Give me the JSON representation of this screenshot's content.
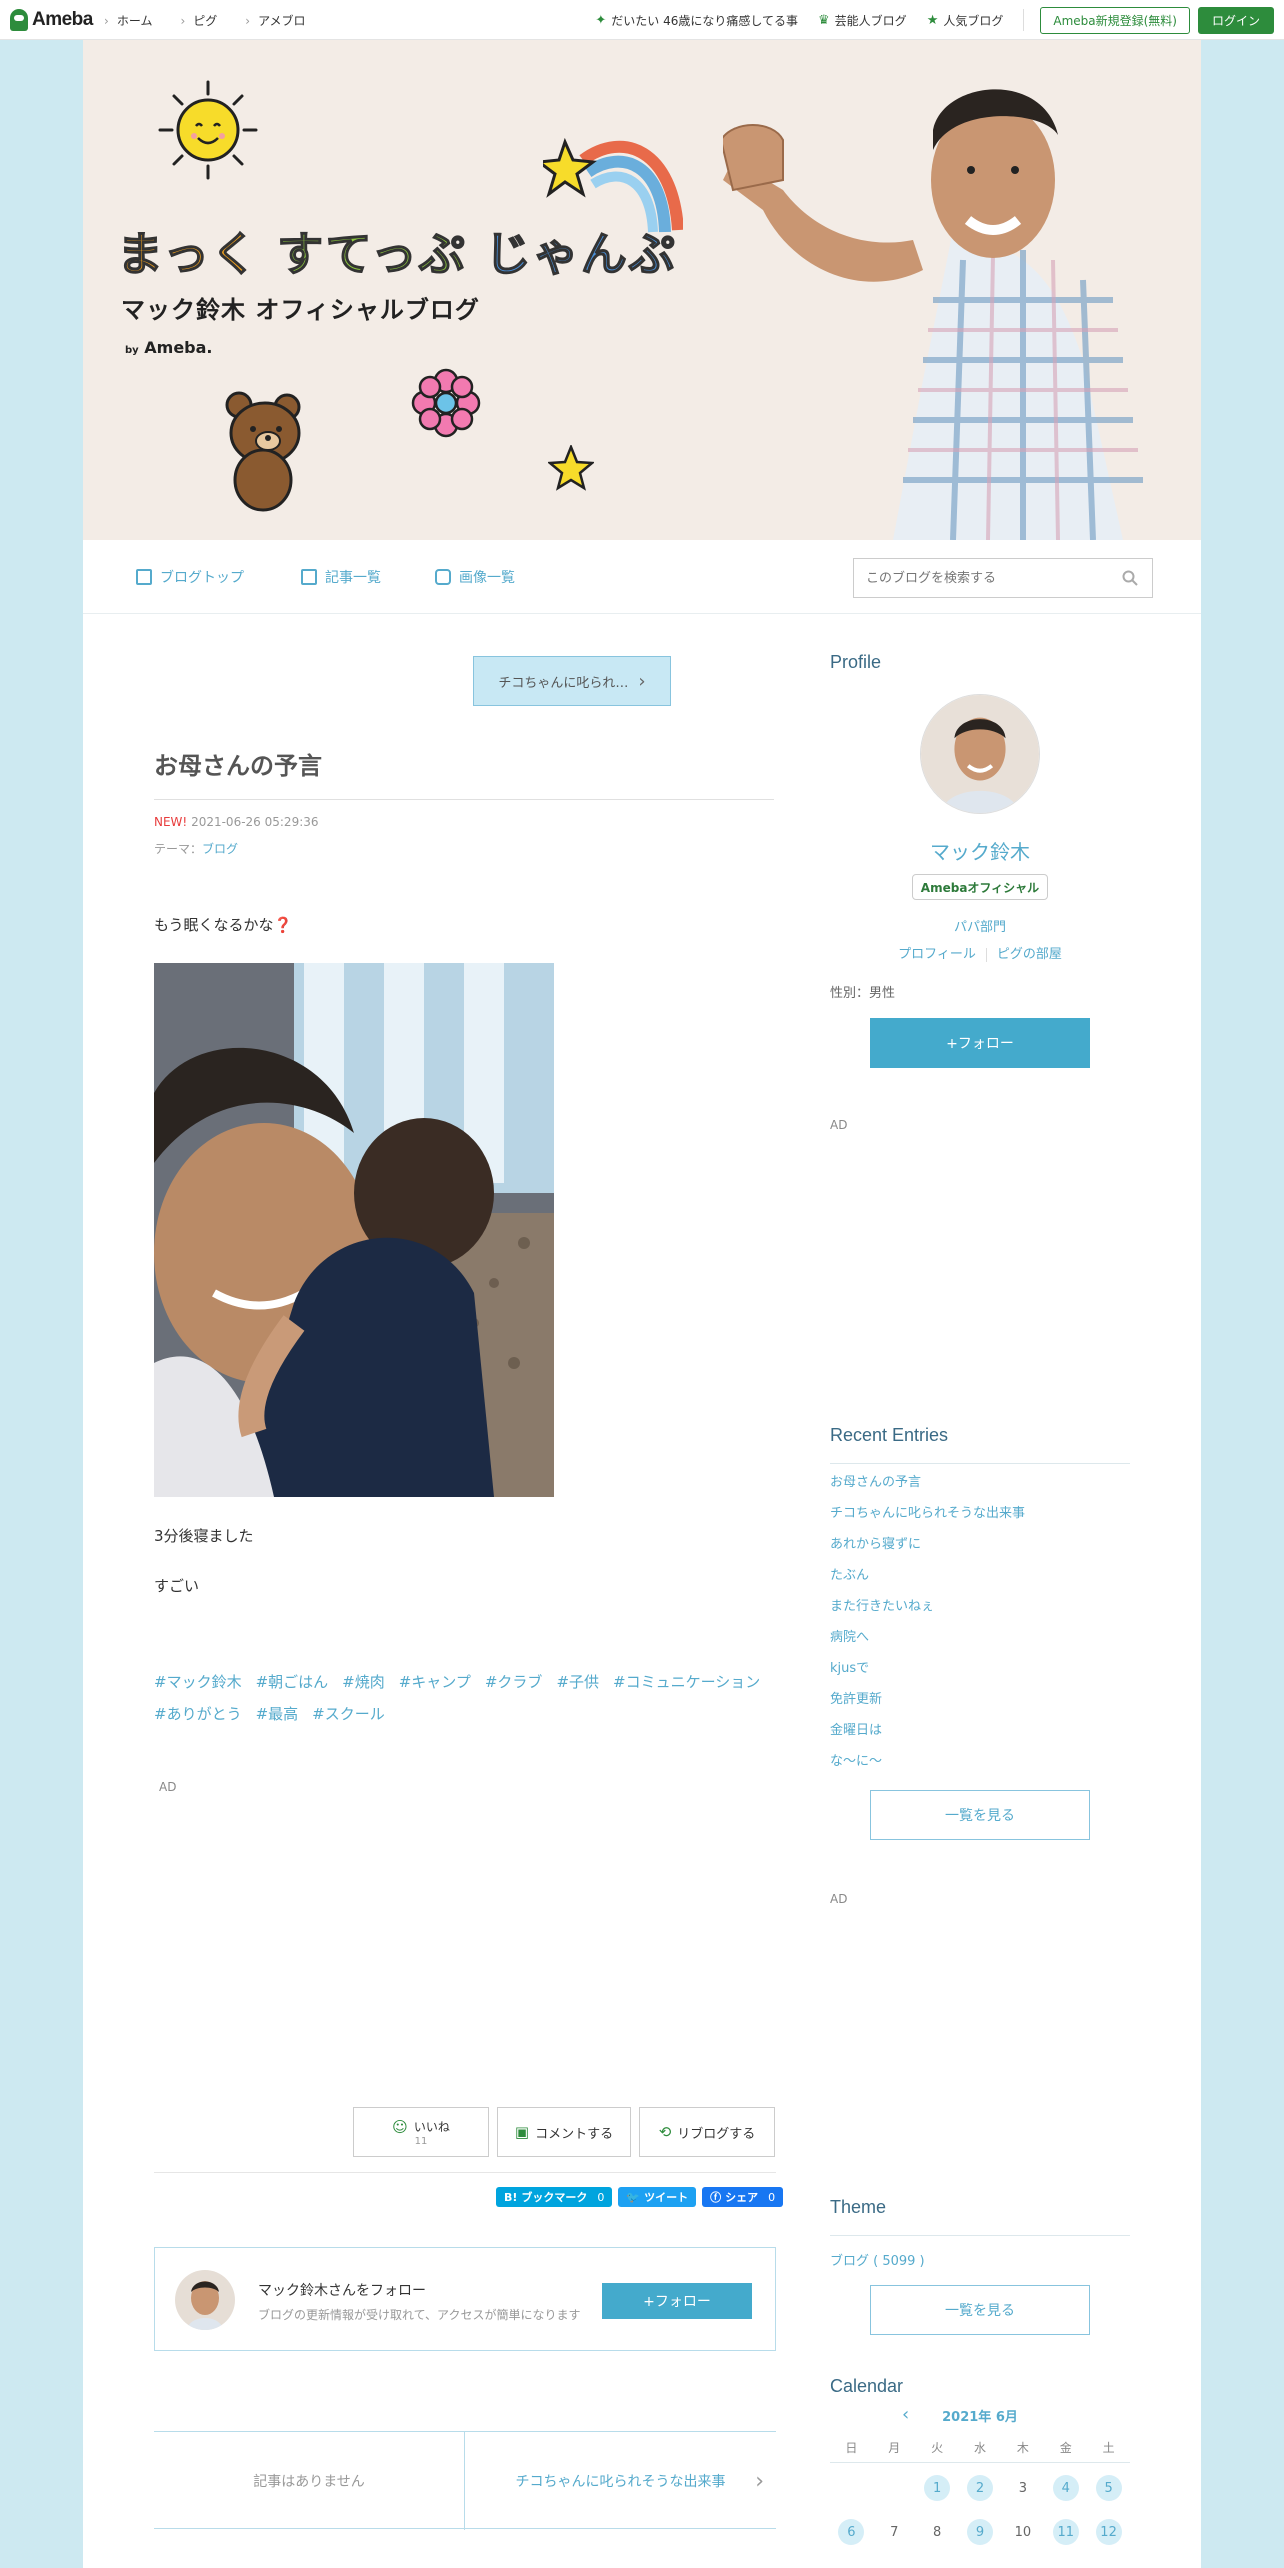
{
  "topbar": {
    "logo": "Ameba",
    "nav": [
      "ホーム",
      "ピグ",
      "アメブロ"
    ],
    "links": [
      "だいたい 46歳になり痛感してる事",
      "芸能人ブログ",
      "人気ブログ"
    ],
    "register": "Ameba新規登録(無料)",
    "login": "ログイン"
  },
  "banner": {
    "title_1": "まっく",
    "title_2": "すてっぷ",
    "title_3": "じゃんぷ",
    "subtitle": "マック鈴木 オフィシャルブログ",
    "by": "by",
    "by_brand": "Ameba."
  },
  "subnav": {
    "top": "ブログトップ",
    "list": "記事一覧",
    "images": "画像一覧",
    "search_placeholder": "このブログを検索する"
  },
  "article": {
    "prev": "チコちゃんに叱られ…",
    "title": "お母さんの予言",
    "new": "NEW!",
    "datetime": "2021-06-26 05:29:36",
    "theme_label": "テーマ：",
    "theme": "ブログ",
    "p1": "もう眠くなるかな",
    "p1_mark": "❓",
    "p2": "3分後寝ました",
    "p3": "すごい",
    "tags": [
      "#マック鈴木",
      "#朝ごはん",
      "#焼肉",
      "#キャンプ",
      "#クラブ",
      "#子供",
      "#コミュニケーション",
      "#ありがとう",
      "#最高",
      "#スクール"
    ],
    "ad": "AD",
    "like": "いいね",
    "like_count": "11",
    "comment": "コメントする",
    "reblog": "リブログする",
    "share_hatena": "ブックマーク",
    "share_hatena_count": "0",
    "share_tweet": "ツイート",
    "share_fb": "シェア",
    "share_fb_count": "0",
    "follow_name": "マック鈴木さんをフォロー",
    "follow_desc": "ブログの更新情報が受け取れて、アクセスが簡単になります",
    "follow_btn": "+フォロー",
    "pager_left": "記事はありません",
    "pager_right": "チコちゃんに叱られそうな出来事"
  },
  "sidebar": {
    "profile_h": "Profile",
    "name": "マック鈴木",
    "badge": "Amebaオフィシャル",
    "category": "パパ部門",
    "link_profile": "プロフィール",
    "link_pig": "ピグの部屋",
    "gender": "性別：男性",
    "follow": "+フォロー",
    "ad": "AD",
    "recent_h": "Recent Entries",
    "entries": [
      "お母さんの予言",
      "チコちゃんに叱られそうな出来事",
      "あれから寝ずに",
      "たぶん",
      "また行きたいねぇ",
      "病院へ",
      "kjusで",
      "免許更新",
      "金曜日は",
      "な〜に〜"
    ],
    "more": "一覧を見る",
    "theme_h": "Theme",
    "theme_item": "ブログ ( 5099 )",
    "calendar_h": "Calendar",
    "cal_month": "2021年 6月",
    "cal_days": [
      "日",
      "月",
      "火",
      "水",
      "木",
      "金",
      "土"
    ],
    "cal_row1": [
      "",
      "",
      "1",
      "2",
      "3",
      "4",
      "5"
    ],
    "cal_row1_has": [
      false,
      false,
      true,
      true,
      false,
      true,
      true
    ],
    "cal_row2": [
      "6",
      "7",
      "8",
      "9",
      "10",
      "11",
      "12"
    ],
    "cal_row2_has": [
      true,
      false,
      false,
      true,
      false,
      true,
      true
    ]
  },
  "colors": {
    "accent": "#55aacc",
    "ameba_green": "#2d8c3c",
    "page_bg": "#cde9f1",
    "follow": "#44aacc"
  }
}
